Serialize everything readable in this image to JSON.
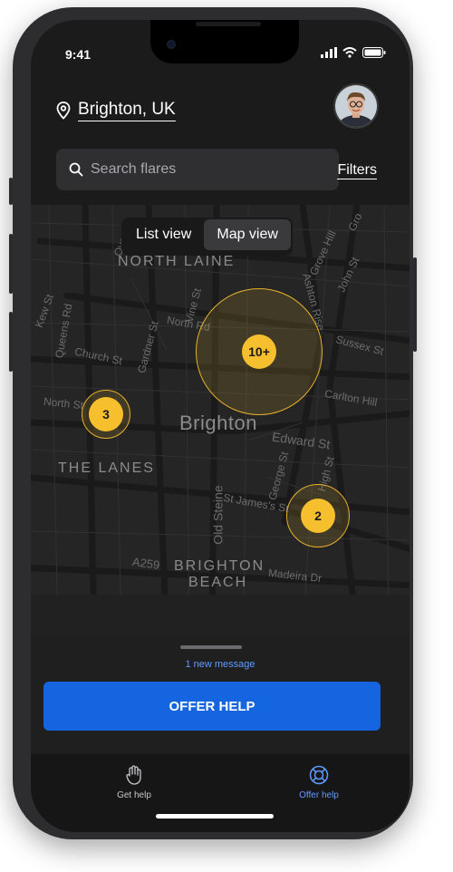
{
  "status": {
    "time": "9:41"
  },
  "header": {
    "location": "Brighton, UK",
    "location_icon": "location-pin-icon",
    "avatar_icon": "user-avatar"
  },
  "search": {
    "placeholder": "Search flares",
    "icon": "search-icon"
  },
  "filters_label": "Filters",
  "view_toggle": {
    "options": [
      "List view",
      "Map view"
    ],
    "selected": "Map view"
  },
  "map": {
    "labels": {
      "north_laine": "NORTH LAINE",
      "brighton": "Brighton",
      "the_lanes": "THE LANES",
      "brighton_beach_1": "BRIGHTON",
      "brighton_beach_2": "BEACH",
      "over_st": "Over St",
      "grove_hill": "Grove Hill",
      "john_st": "John St",
      "ashton_rise": "Ashton Rise",
      "sussex_st": "Sussex St",
      "carlton_hill": "Carlton Hill",
      "edward_st": "Edward St",
      "high_st": "High St",
      "george_st": "George St",
      "st_james_st": "St James's St",
      "old_steine": "Old Steine",
      "madeira_dr": "Madeira Dr",
      "a259": "A259",
      "queens_rd": "Queens Rd",
      "church_st": "Church St",
      "gardner_st": "Gardner St",
      "vine_st": "Vine St",
      "north_rd": "North Rd",
      "north_st": "North St",
      "ew_st": "Kew St",
      "gro": "Gro"
    },
    "clusters": [
      {
        "label": "10+"
      },
      {
        "label": "3"
      },
      {
        "label": "2"
      }
    ],
    "cluster_color": "#f6bf2d"
  },
  "sheet": {
    "new_message": "1 new message",
    "offer_button": "OFFER HELP"
  },
  "tabbar": {
    "items": [
      {
        "label": "Get help",
        "icon": "hand-icon",
        "active": false
      },
      {
        "label": "Offer help",
        "icon": "lifebuoy-icon",
        "active": true
      }
    ]
  },
  "colors": {
    "accent": "#1565e0",
    "active_tab": "#5f9bff"
  }
}
